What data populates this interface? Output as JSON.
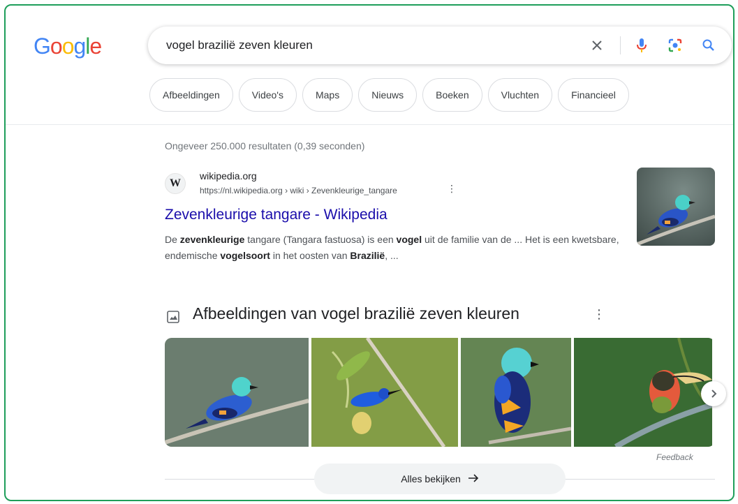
{
  "logo": {
    "letters": [
      "G",
      "o",
      "o",
      "g",
      "l",
      "e"
    ],
    "colors": [
      "#4285F4",
      "#EA4335",
      "#FBBC05",
      "#4285F4",
      "#34A853",
      "#EA4335"
    ]
  },
  "search": {
    "query": "vogel brazilië zeven kleuren",
    "icons": [
      "close-icon",
      "microphone-icon",
      "lens-icon",
      "search-icon"
    ]
  },
  "chips": [
    "Afbeeldingen",
    "Video's",
    "Maps",
    "Nieuws",
    "Boeken",
    "Vluchten",
    "Financieel"
  ],
  "stats": "Ongeveer 250.000 resultaten (0,39 seconden)",
  "result": {
    "favicon": "W",
    "site_name": "wikipedia.org",
    "url": "https://nl.wikipedia.org › wiki › Zevenkleurige_tangare",
    "title": "Zevenkleurige tangare - Wikipedia",
    "snippet_parts": [
      {
        "t": "De ",
        "b": false
      },
      {
        "t": "zevenkleurige",
        "b": true
      },
      {
        "t": " tangare (Tangara fastuosa) is een ",
        "b": false
      },
      {
        "t": "vogel",
        "b": true
      },
      {
        "t": " uit de familie van de ... Het is een kwetsbare, endemische ",
        "b": false
      },
      {
        "t": "vogelsoort",
        "b": true
      },
      {
        "t": " in het oosten van ",
        "b": false
      },
      {
        "t": "Brazilië",
        "b": true
      },
      {
        "t": ", ...",
        "b": false
      }
    ]
  },
  "images_section": {
    "title": "Afbeeldingen van vogel brazilië zeven kleuren",
    "feedback": "Feedback",
    "see_all": "Alles bekijken"
  },
  "colors": {
    "link": "#1a0dab",
    "frame_border": "#1e9e5a"
  }
}
